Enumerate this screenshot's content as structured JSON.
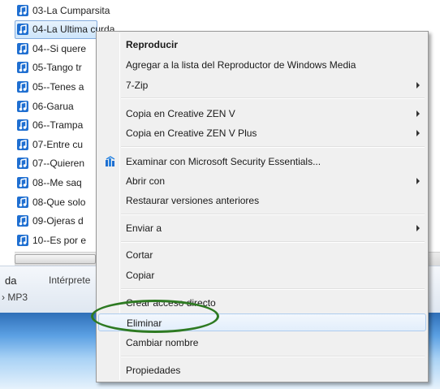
{
  "files": [
    {
      "name": "03-La Cumparsita"
    },
    {
      "name": "04-La Ultima curda"
    },
    {
      "name": "04--Si quere"
    },
    {
      "name": "05-Tango tr"
    },
    {
      "name": "05--Tenes a"
    },
    {
      "name": "06-Garua"
    },
    {
      "name": "06--Trampa"
    },
    {
      "name": "07-Entre cu"
    },
    {
      "name": "07--Quieren"
    },
    {
      "name": "08--Me saq"
    },
    {
      "name": "08-Que solo"
    },
    {
      "name": "09-Ojeras d"
    },
    {
      "name": "10--Es por e"
    }
  ],
  "selected_file_index": 1,
  "details": {
    "title_fragment": "da",
    "artist_label": "Intérprete",
    "type_fragment": "› MP3"
  },
  "menu": {
    "play": "Reproducir",
    "add_to_wmp": "Agregar a la lista del Reproductor de Windows Media",
    "seven_zip": "7-Zip",
    "copy_zen_v": "Copia en Creative ZEN V",
    "copy_zen_v_plus": "Copia en Creative ZEN V Plus",
    "scan_mse": "Examinar con Microsoft Security Essentials...",
    "open_with": "Abrir con",
    "restore_versions": "Restaurar versiones anteriores",
    "send_to": "Enviar a",
    "cut": "Cortar",
    "copy": "Copiar",
    "create_shortcut": "Crear acceso directo",
    "delete": "Eliminar",
    "rename": "Cambiar nombre",
    "properties": "Propiedades"
  },
  "colors": {
    "icon_blue": "#1f6fd1",
    "highlight_green": "#2e7a22"
  },
  "icons": {
    "file": "music-note-icon",
    "mse": "security-shield-icon",
    "submenu": "chevron-right-icon"
  }
}
